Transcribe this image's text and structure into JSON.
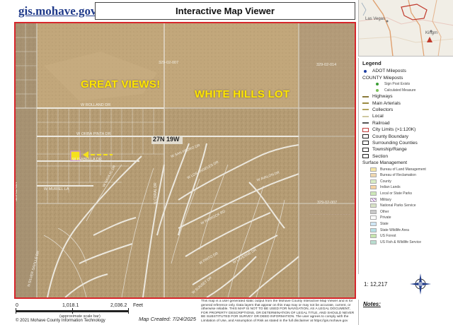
{
  "header": {
    "logo_text": "gis.mohave.gov",
    "title": "Interactive Map Viewer"
  },
  "inset_map": {
    "place_labels": [
      "Las Vegas",
      "Kingm"
    ]
  },
  "map": {
    "annotations": {
      "great_views": "GREAT VIEWS!",
      "white_hills_lot": "WHITE HILLS LOT"
    },
    "township_label": "27N 19W",
    "parcel_labels": [
      "329-02-007",
      "329-02-014",
      "329-02-007",
      "329-02-007"
    ],
    "street_labels": [
      "W ROLLAND DR",
      "W ORBA PINTA DR",
      "W ISABELLA DR",
      "W MURIEL LA",
      "W NAVAJO DR",
      "W LOS ANGELES DR",
      "N SILVER SAVILLE DR",
      "N CORAL DR",
      "W RIMROCK RD",
      "W LAVERNE DR",
      "W PINTO DR",
      "W SUNSET DR",
      "W SAN PEDRO DR",
      "W AVALON DR"
    ],
    "colors": {
      "frame": "#d6262b",
      "annotation_text": "#ffe600",
      "subject_parcel": "#f5e11c",
      "arrow": "#f5e11c"
    }
  },
  "legend": {
    "title": "Legend",
    "items": [
      {
        "label": "ADOT Mileposts",
        "kind": "dot",
        "color": "#1f3fa3",
        "level": 0
      },
      {
        "label": "COUNTY Mileposts",
        "kind": "none",
        "color": "",
        "level": 0
      },
      {
        "label": "Sign Post Exists",
        "kind": "dot",
        "color": "#3a9e34",
        "level": 2
      },
      {
        "label": "Calculated Measure",
        "kind": "dot",
        "color": "#7bbf5a",
        "level": 2
      },
      {
        "label": "Highways",
        "kind": "line",
        "color": "#8a7a3a",
        "level": 0
      },
      {
        "label": "Main Arterials",
        "kind": "line",
        "color": "#9b8a42",
        "level": 0
      },
      {
        "label": "Collectors",
        "kind": "line",
        "color": "#b2a460",
        "level": 0
      },
      {
        "label": "Local",
        "kind": "line",
        "color": "#cfc8a2",
        "level": 0
      },
      {
        "label": "Railroad",
        "kind": "line",
        "color": "#555555",
        "level": 0
      },
      {
        "label": "City Limits (>1:120K)",
        "kind": "box",
        "color": "#c23b3b",
        "level": 0
      },
      {
        "label": "County Boundary",
        "kind": "box",
        "color": "#222222",
        "level": 0
      },
      {
        "label": "Surrounding Counties",
        "kind": "box",
        "color": "#222222",
        "level": 0
      },
      {
        "label": "Township/Range",
        "kind": "box",
        "color": "#222222",
        "level": 0
      },
      {
        "label": "Section",
        "kind": "box",
        "color": "#222222",
        "level": 0
      },
      {
        "label": "Surface Management",
        "kind": "none",
        "color": "",
        "level": 0
      },
      {
        "label": "Bureau of Land Management",
        "kind": "fill",
        "color": "#f6e7a6",
        "level": 1
      },
      {
        "label": "Bureau of Reclamation",
        "kind": "fill",
        "color": "#f0d8b0",
        "level": 1
      },
      {
        "label": "County",
        "kind": "fill",
        "color": "#d9eec4",
        "level": 1
      },
      {
        "label": "Indian Lands",
        "kind": "fill",
        "color": "#f6d3a2",
        "level": 1
      },
      {
        "label": "Local or State Parks",
        "kind": "fill",
        "color": "#cde8b8",
        "level": 1
      },
      {
        "label": "Military",
        "kind": "hatch",
        "color": "#a86bc2",
        "level": 1
      },
      {
        "label": "National Parks Service",
        "kind": "fill",
        "color": "#d8e2c6",
        "level": 1
      },
      {
        "label": "Other",
        "kind": "fill",
        "color": "#c9c9c9",
        "level": 1
      },
      {
        "label": "Private",
        "kind": "fill",
        "color": "#ffffff",
        "level": 1
      },
      {
        "label": "State",
        "kind": "fill",
        "color": "#cfe6f4",
        "level": 1
      },
      {
        "label": "State Wildlife Area",
        "kind": "fill",
        "color": "#b7e0e6",
        "level": 1
      },
      {
        "label": "US Forest",
        "kind": "fill",
        "color": "#c8e6b0",
        "level": 1
      },
      {
        "label": "US Fish & Wildlife Service",
        "kind": "fill",
        "color": "#b9ddd0",
        "level": 1
      }
    ],
    "scale_ratio": "1: 12,217"
  },
  "scalebar": {
    "labels": [
      "0",
      "1,018.1",
      "2,036.2"
    ],
    "unit": "Feet",
    "approx_note": "(approximate scale bar)"
  },
  "footer": {
    "copyright": "© 2021 Mohave County Information Technology",
    "map_created": "Map Created: 7/24/2025",
    "disclaimer": "This map is a user generated static output from the Mohave County Interactive Map Viewer and is for general reference only. Data layers that appear on this map may or may not be accurate, current, or otherwise reliable. THIS MAP IS NOT TO BE USED FOR NAVIGATION, AS A LEGAL DOCUMENT, FOR PROPERTY DESCRIPTIONS, OR DETERMINATION OF LEGAL TITLE, AND SHOULD NEVER BE SUBSTITUTED FOR SURVEY OR DEED INFORMATION. The user agrees to comply with the Limitation of Use, and Assumption of Risk as stated in the full disclaimer at https://gis.mohave.gov",
    "notes_label": "Notes:"
  }
}
